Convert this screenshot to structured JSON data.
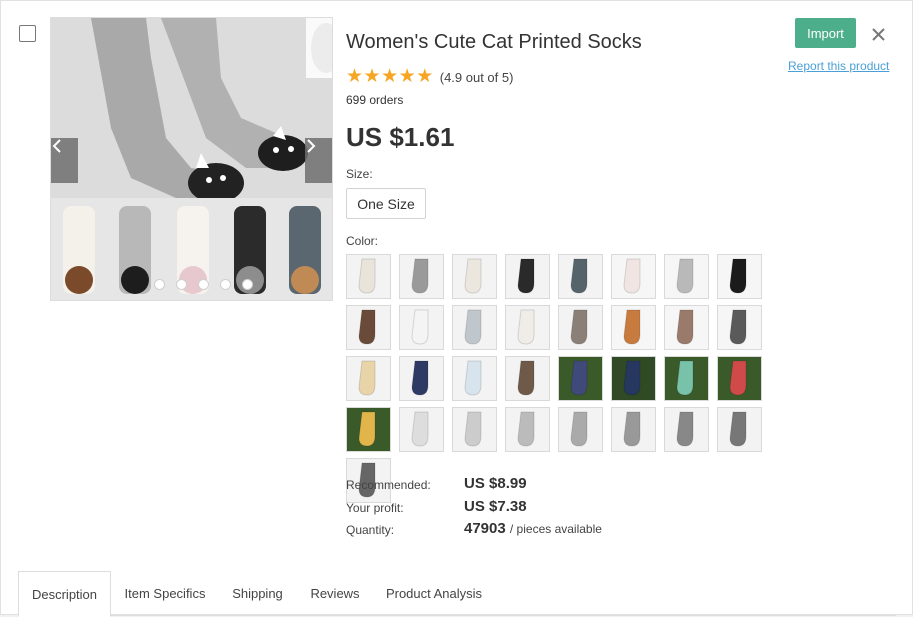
{
  "product": {
    "title": "Women's Cute Cat Printed Socks",
    "rating_text": "(4.9 out of 5)",
    "stars": 5,
    "orders": "699 orders",
    "price": "US $1.61"
  },
  "size": {
    "label": "Size:",
    "option": "One Size"
  },
  "color": {
    "label": "Color:",
    "swatch_count": 33
  },
  "stats": {
    "recommended_label": "Recommended:",
    "recommended_value": "US $8.99",
    "profit_label": "Your profit:",
    "profit_value": "US $7.38",
    "quantity_label": "Quantity:",
    "quantity_value": "47903",
    "quantity_suffix": "/ pieces available"
  },
  "actions": {
    "import_label": "Import",
    "report_label": "Report this product"
  },
  "tabs": [
    {
      "label": "Description",
      "active": true
    },
    {
      "label": "Item Specifics"
    },
    {
      "label": "Shipping"
    },
    {
      "label": "Reviews"
    },
    {
      "label": "Product Analysis"
    }
  ],
  "gallery": {
    "dot_count": 5
  },
  "colors": {
    "accent": "#4cae8a",
    "star": "#f6a623",
    "link": "#4aa0d6"
  }
}
